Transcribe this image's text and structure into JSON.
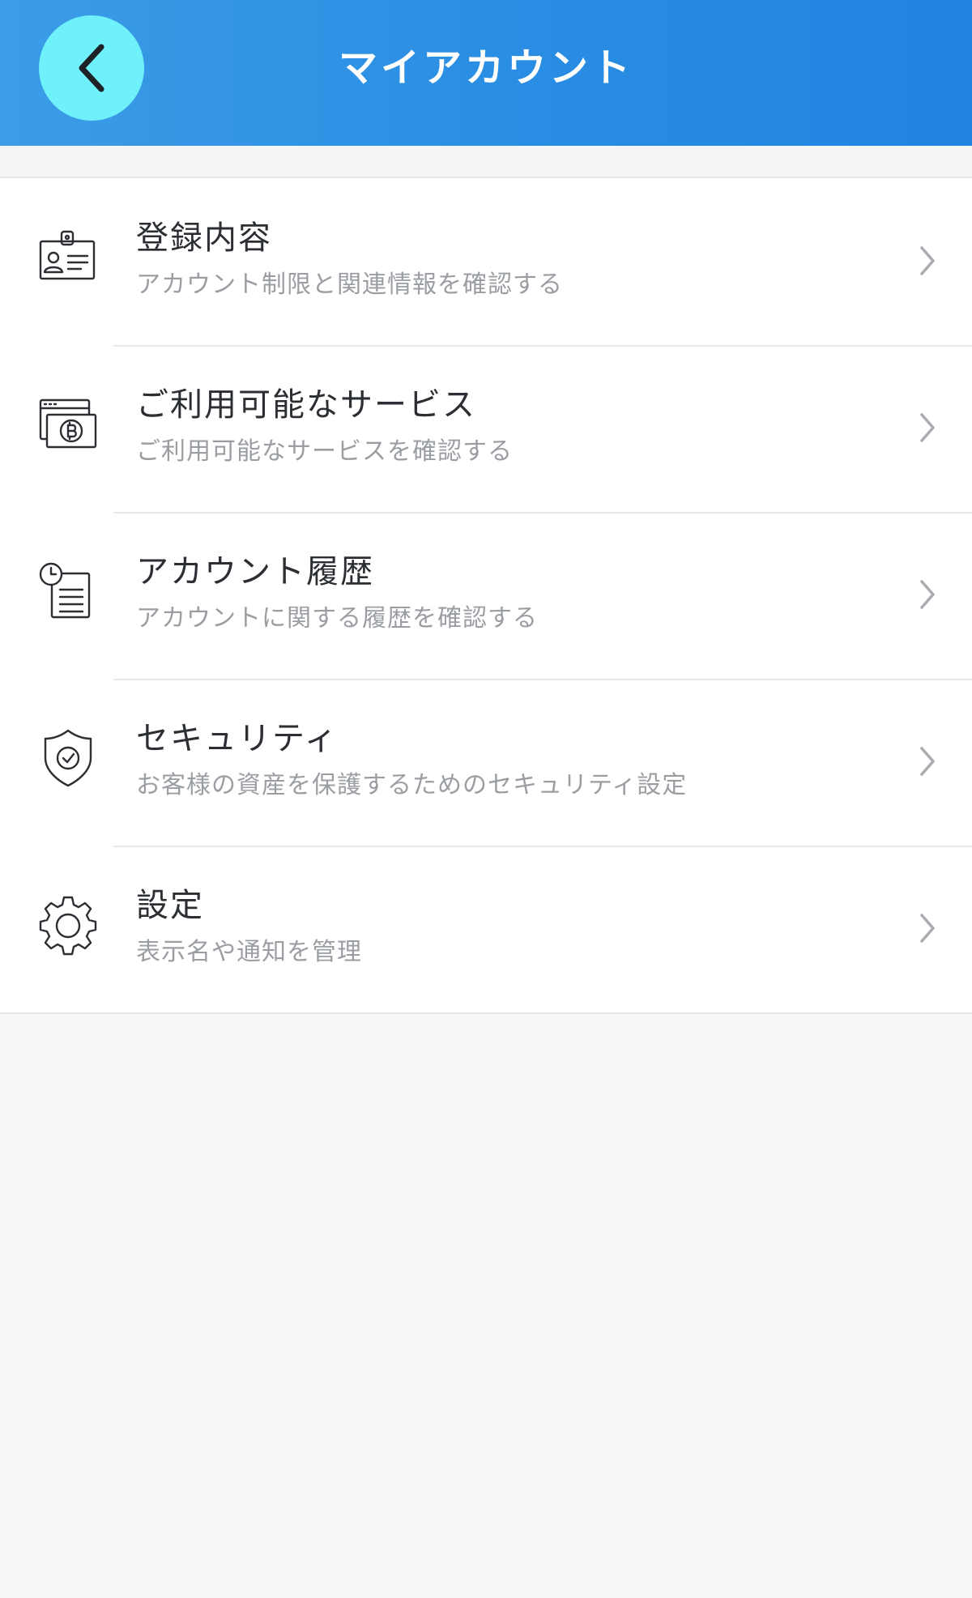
{
  "header": {
    "title": "マイアカウント",
    "back_icon": "chevron-left-icon",
    "background_color": "#2a8ee3",
    "back_button_color": "#6ef1fb"
  },
  "menu": {
    "items": [
      {
        "id": "registration",
        "icon": "id-card-icon",
        "title": "登録内容",
        "subtitle": "アカウント制限と関連情報を確認する"
      },
      {
        "id": "services",
        "icon": "bitcoin-window-icon",
        "title": "ご利用可能なサービス",
        "subtitle": "ご利用可能なサービスを確認する"
      },
      {
        "id": "history",
        "icon": "clock-document-icon",
        "title": "アカウント履歴",
        "subtitle": "アカウントに関する履歴を確認する"
      },
      {
        "id": "security",
        "icon": "shield-check-icon",
        "title": "セキュリティ",
        "subtitle": "お客様の資産を保護するためのセキュリティ設定"
      },
      {
        "id": "settings",
        "icon": "gear-icon",
        "title": "設定",
        "subtitle": "表示名や通知を管理"
      }
    ]
  }
}
